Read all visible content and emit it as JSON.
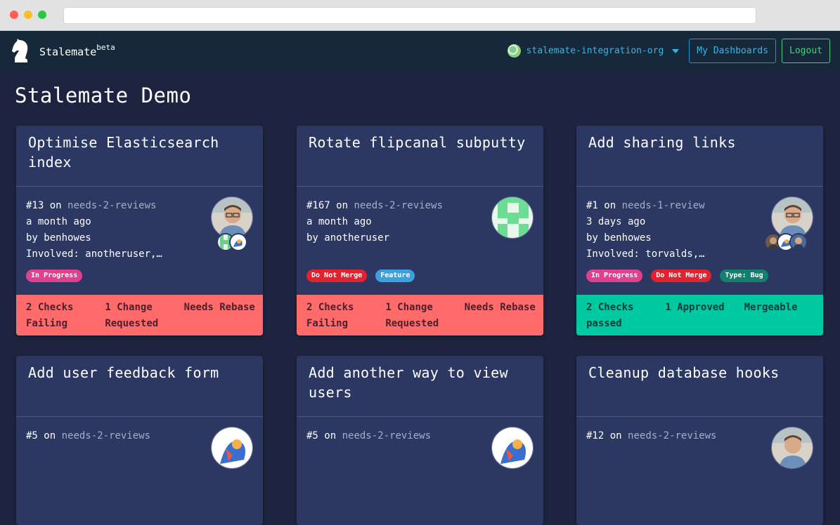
{
  "nav": {
    "brand": "Stalemate",
    "brand_sup": "beta",
    "org_name": "stalemate-integration-org",
    "dashboards_label": "My Dashboards",
    "logout_label": "Logout"
  },
  "page": {
    "title": "Stalemate Demo"
  },
  "colors": {
    "status_failing": "#ff6b6b",
    "status_passing": "#00c8a0",
    "label_in_progress": "#e0418f",
    "label_do_not_merge": "#e3212f",
    "label_feature": "#3ba0dd",
    "label_type_bug": "#12806e"
  },
  "cards": [
    {
      "title": "Optimise Elasticsearch index",
      "number": "#13",
      "on": "on",
      "branch": "needs-2-reviews",
      "time": "a month ago",
      "by": "by benhowes",
      "involved": "Involved: anotheruser,…",
      "labels": [
        {
          "text": "In Progress"
        }
      ],
      "status": [
        "2 Checks Failing",
        "1 Change Requested",
        "Needs Rebase"
      ]
    },
    {
      "title": "Rotate flipcanal subputty",
      "number": "#167",
      "on": "on",
      "branch": "needs-2-reviews",
      "time": "a month ago",
      "by": "by anotheruser",
      "involved": "",
      "labels": [
        {
          "text": "Do Not Merge"
        },
        {
          "text": "Feature"
        }
      ],
      "status": [
        "2 Checks Failing",
        "1 Change Requested",
        "Needs Rebase"
      ]
    },
    {
      "title": "Add sharing links",
      "number": "#1",
      "on": "on",
      "branch": "needs-1-review",
      "time": "3 days ago",
      "by": "by benhowes",
      "involved": "Involved: torvalds,…",
      "labels": [
        {
          "text": "In Progress"
        },
        {
          "text": "Do Not Merge"
        },
        {
          "text": "Type: Bug"
        }
      ],
      "status": [
        "2 Checks passed",
        "1 Approved",
        "Mergeable"
      ]
    },
    {
      "title": "Add user feedback form",
      "number": "#5",
      "on": "on",
      "branch": "needs-2-reviews"
    },
    {
      "title": "Add another way to view users",
      "number": "#5",
      "on": "on",
      "branch": "needs-2-reviews"
    },
    {
      "title": "Cleanup database hooks",
      "number": "#12",
      "on": "on",
      "branch": "needs-2-reviews"
    }
  ]
}
